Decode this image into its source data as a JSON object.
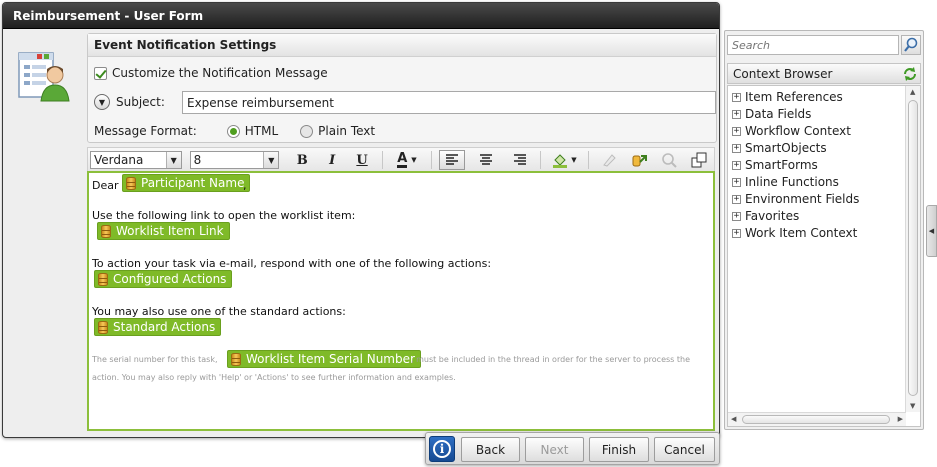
{
  "window": {
    "title": "Reimbursement - User Form"
  },
  "settings": {
    "header": "Event Notification Settings",
    "customize_label": "Customize the Notification Message",
    "customize_checked": true,
    "subject_label": "Subject:",
    "subject_value": "Expense reimbursement",
    "format_label": "Message Format:",
    "format_options": [
      "HTML",
      "Plain Text"
    ],
    "format_selected": "HTML"
  },
  "toolbar": {
    "font_family": "Verdana",
    "font_size": "8",
    "bold": "B",
    "italic": "I",
    "underline": "U",
    "font_color": "A"
  },
  "editor": {
    "greeting": "Dear",
    "greeting_suffix": ",",
    "field_participant": "Participant Name",
    "line_link": "Use the following link to open the worklist item:",
    "field_worklist_link": "Worklist Item Link",
    "line_action": "To action your task via e-mail, respond with one of the following actions:",
    "field_configured": "Configured Actions",
    "line_standard": "You may also use one of the standard actions:",
    "field_standard": "Standard Actions",
    "serial_before": "The serial number for this task,",
    "field_serial": "Worklist Item Serial Number",
    "serial_after": ", must be included in the thread in order for the server to process the",
    "serial_line2": "action. You may also reply with 'Help' or 'Actions' to see further information and examples."
  },
  "footer": {
    "back": "Back",
    "next": "Next",
    "finish": "Finish",
    "cancel": "Cancel"
  },
  "context_browser": {
    "search_placeholder": "Search",
    "header": "Context Browser",
    "items": [
      "Item References",
      "Data Fields",
      "Workflow Context",
      "SmartObjects",
      "SmartForms",
      "Inline Functions",
      "Environment Fields",
      "Favorites",
      "Work Item Context"
    ]
  },
  "colors": {
    "field_green": "#7fba28",
    "editor_border": "#8cbf3b",
    "titlebar": "#2b2b2b",
    "info_blue": "#1f5aa8"
  }
}
